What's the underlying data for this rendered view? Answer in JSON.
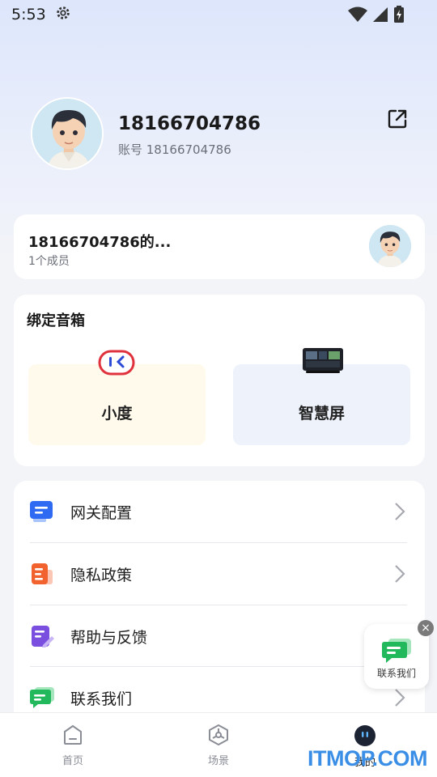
{
  "status_bar": {
    "time": "5:53"
  },
  "profile": {
    "phone": "18166704786",
    "account_line": "账号 18166704786"
  },
  "family": {
    "name": "18166704786的...",
    "members": "1个成员"
  },
  "speakers": {
    "title": "绑定音箱",
    "items": [
      {
        "label": "小度"
      },
      {
        "label": "智慧屏"
      }
    ]
  },
  "menu": {
    "items": [
      {
        "label": "网关配置",
        "icon": "gateway-config-icon",
        "color": "#2f6bf2"
      },
      {
        "label": "隐私政策",
        "icon": "privacy-policy-icon",
        "color": "#f2622e"
      },
      {
        "label": "帮助与反馈",
        "icon": "help-feedback-icon",
        "color": "#7a4fe0"
      },
      {
        "label": "联系我们",
        "icon": "contact-us-icon",
        "color": "#22b85c"
      }
    ]
  },
  "floating": {
    "label": "联系我们"
  },
  "tabbar": {
    "items": [
      {
        "label": "首页"
      },
      {
        "label": "场景"
      },
      {
        "label": "我的"
      }
    ]
  },
  "watermark": "ITMOP.COM"
}
